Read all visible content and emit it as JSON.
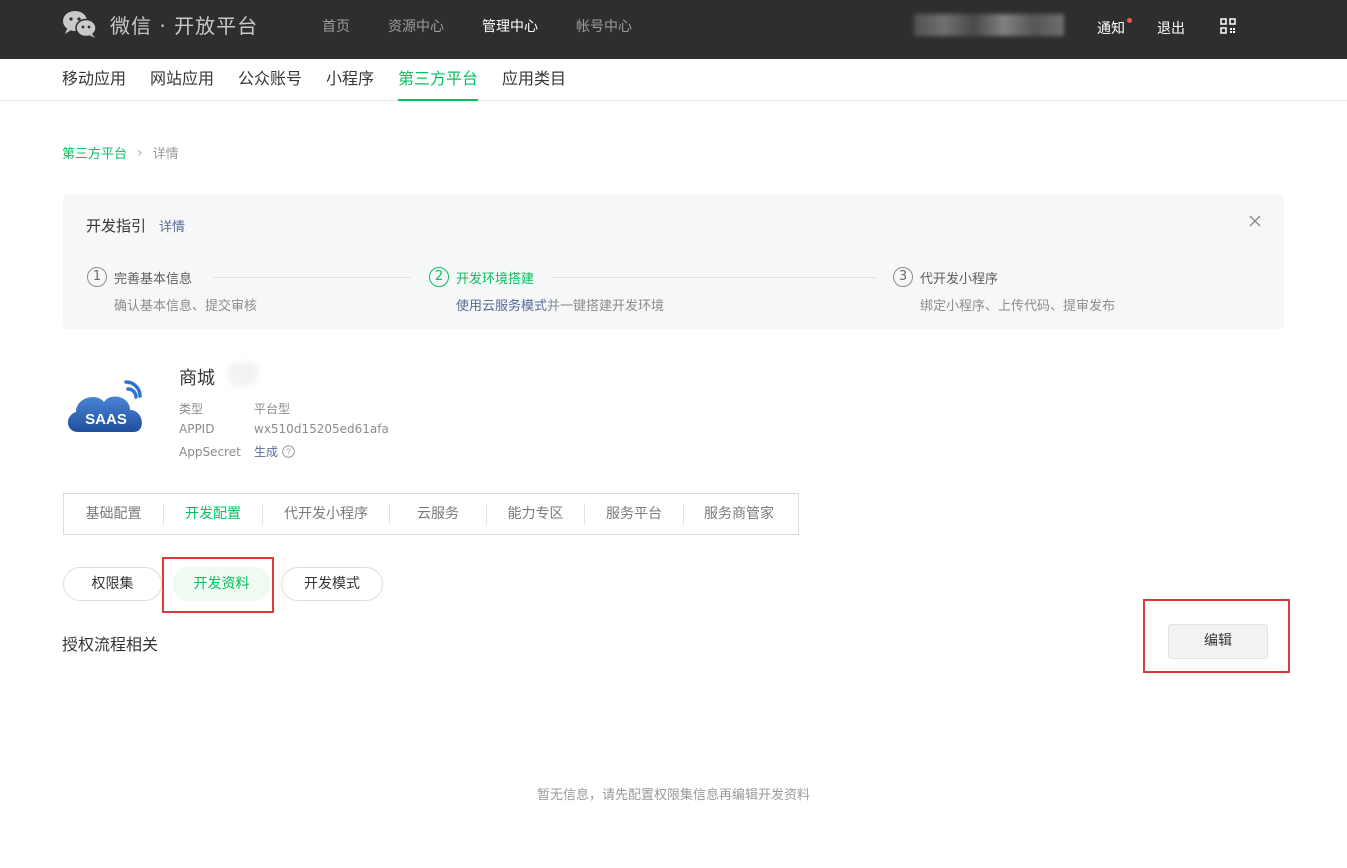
{
  "header": {
    "logo_text": "微信 · 开放平台",
    "nav": [
      {
        "label": "首页",
        "active": false
      },
      {
        "label": "资源中心",
        "active": false
      },
      {
        "label": "管理中心",
        "active": true
      },
      {
        "label": "帐号中心",
        "active": false
      }
    ],
    "notice_label": "通知",
    "logout_label": "退出"
  },
  "subnav": {
    "items": [
      {
        "label": "移动应用",
        "active": false
      },
      {
        "label": "网站应用",
        "active": false
      },
      {
        "label": "公众账号",
        "active": false
      },
      {
        "label": "小程序",
        "active": false
      },
      {
        "label": "第三方平台",
        "active": true
      },
      {
        "label": "应用类目",
        "active": false
      }
    ]
  },
  "breadcrumb": {
    "parent": "第三方平台",
    "separator": "›",
    "current": "详情"
  },
  "guide": {
    "title": "开发指引",
    "detail_link": "详情",
    "steps": [
      {
        "num": "1",
        "title": "完善基本信息",
        "desc": "确认基本信息、提交审核"
      },
      {
        "num": "2",
        "title": "开发环境搭建",
        "desc_link": "使用云服务模式",
        "desc": "并一键搭建开发环境"
      },
      {
        "num": "3",
        "title": "代开发小程序",
        "desc": "绑定小程序、上传代码、提审发布"
      }
    ]
  },
  "app": {
    "logo_text": "SAAS",
    "name": "商城",
    "type_label": "类型",
    "type_value": "平台型",
    "appid_label": "APPID",
    "appid_value": "wx510d15205ed61afa",
    "secret_label": "AppSecret",
    "secret_action": "生成"
  },
  "config_tabs": [
    {
      "label": "基础配置",
      "active": false
    },
    {
      "label": "开发配置",
      "active": true
    },
    {
      "label": "代开发小程序",
      "active": false
    },
    {
      "label": "云服务",
      "active": false
    },
    {
      "label": "能力专区",
      "active": false
    },
    {
      "label": "服务平台",
      "active": false
    },
    {
      "label": "服务商管家",
      "active": false
    }
  ],
  "pills": [
    {
      "label": "权限集",
      "active": false
    },
    {
      "label": "开发资料",
      "active": true
    },
    {
      "label": "开发模式",
      "active": false
    }
  ],
  "section": {
    "title": "授权流程相关",
    "edit_label": "编辑"
  },
  "empty_tip": "暂无信息，请先配置权限集信息再编辑开发资料",
  "colors": {
    "accent": "#07c160",
    "link": "#576b95",
    "header_bg": "#2e2e2e",
    "highlight_frame": "#e13a3a"
  }
}
